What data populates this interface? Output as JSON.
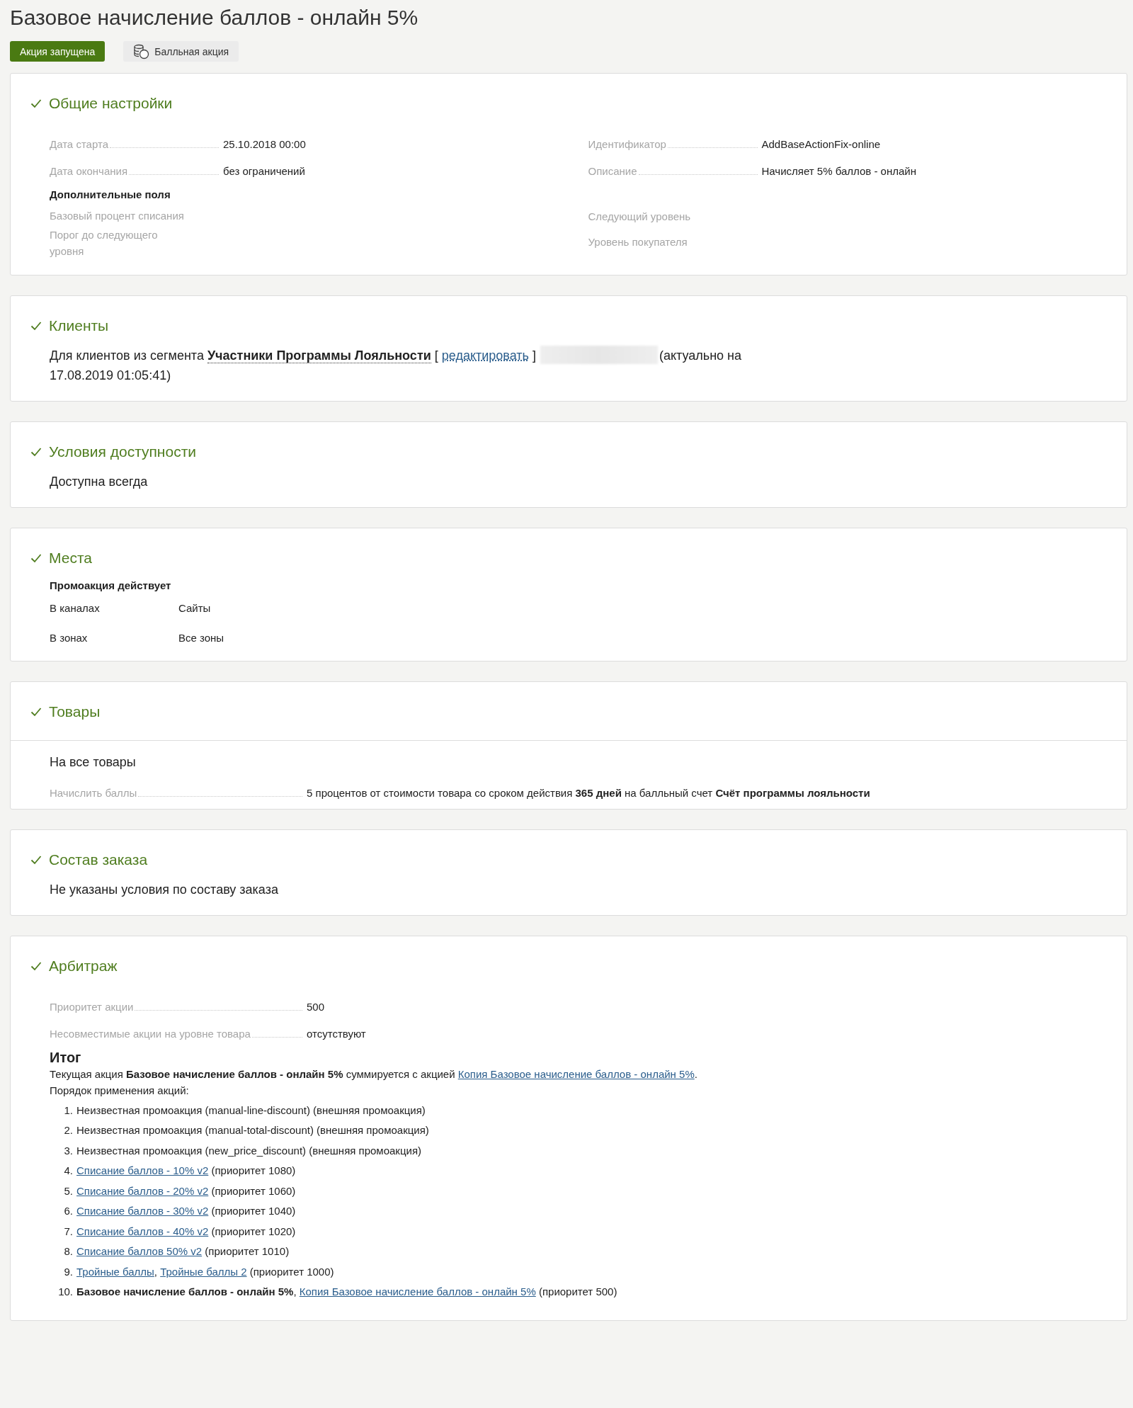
{
  "title": "Базовое начисление баллов - онлайн 5%",
  "badges": [
    {
      "kind": "status",
      "label": "Акция запущена"
    },
    {
      "kind": "type",
      "label": "Балльная акция"
    }
  ],
  "sections": [
    {
      "kind": "general",
      "title": "Общие настройки",
      "complete": true,
      "left_fields": [
        {
          "label": "Дата старта",
          "value": "25.10.2018 00:00"
        },
        {
          "label": "Дата окончания",
          "value": "без ограничений"
        }
      ],
      "right_fields": [
        {
          "label": "Идентификатор",
          "value": "AddBaseActionFix-online"
        },
        {
          "label": "Описание",
          "value": "Начисляет 5% баллов - онлайн"
        }
      ],
      "extra_title": "Дополнительные поля",
      "extra_left": [
        "Базовый процент списания",
        "Порог до следующего уровня"
      ],
      "extra_right": [
        "Следующий уровень",
        "Уровень покупателя"
      ]
    },
    {
      "kind": "clients",
      "title": "Клиенты",
      "complete": true,
      "before": "Для клиентов из сегмента",
      "segment": "Участники Программы Лояльности",
      "open": "[",
      "link": "редактировать",
      "close": "]",
      "after": "(актуально на 17.08.2019 01:05:41)"
    },
    {
      "kind": "text",
      "title": "Условия доступности",
      "complete": true,
      "text": "Доступна всегда"
    },
    {
      "kind": "places",
      "title": "Места",
      "complete": true,
      "subtitle": "Промоакция действует",
      "rows": [
        {
          "label": "В каналах",
          "value": "Сайты"
        },
        {
          "label": "В зонах",
          "value": "Все зоны"
        }
      ]
    },
    {
      "kind": "products",
      "title": "Товары",
      "complete": true,
      "text": "На все товары",
      "field": {
        "label": "Начислить баллы",
        "value": "5 процентов от стоимости товара со сроком действия **365 дней** на балльный счет **Счёт программы лояльности**"
      }
    },
    {
      "kind": "text",
      "title": "Состав заказа",
      "complete": true,
      "text": "Не указаны условия по составу заказа"
    },
    {
      "kind": "arbitration",
      "title": "Арбитраж",
      "complete": true,
      "fields": [
        {
          "label": "Приоритет акции",
          "value": "500"
        },
        {
          "label": "Несовместимые акции на уровне товара",
          "value": "отсутствуют"
        }
      ],
      "summary_title": "Итог",
      "summary": [
        {
          "kind": "text",
          "text": "Текущая акция **Базовое начисление баллов - онлайн 5%** суммируется с акцией "
        },
        {
          "kind": "link",
          "text": "Копия Базовое начисление баллов - онлайн 5%"
        },
        {
          "kind": "text",
          "text": "."
        }
      ],
      "order_title": "Порядок применения акций:",
      "order": [
        {
          "number": "1.",
          "parts": [
            {
              "kind": "text",
              "text": "Неизвестная промоакция (manual-line-discount) (внешняя промоакция)"
            }
          ]
        },
        {
          "number": "2.",
          "parts": [
            {
              "kind": "text",
              "text": "Неизвестная промоакция (manual-total-discount) (внешняя промоакция)"
            }
          ]
        },
        {
          "number": "3.",
          "parts": [
            {
              "kind": "text",
              "text": "Неизвестная промоакция (new_price_discount) (внешняя промоакция)"
            }
          ]
        },
        {
          "number": "4.",
          "parts": [
            {
              "kind": "link",
              "text": "Списание баллов - 10% v2"
            },
            {
              "kind": "text",
              "text": " (приоритет 1080)"
            }
          ]
        },
        {
          "number": "5.",
          "parts": [
            {
              "kind": "link",
              "text": "Списание баллов - 20% v2"
            },
            {
              "kind": "text",
              "text": " (приоритет 1060)"
            }
          ]
        },
        {
          "number": "6.",
          "parts": [
            {
              "kind": "link",
              "text": "Списание баллов - 30% v2"
            },
            {
              "kind": "text",
              "text": " (приоритет 1040)"
            }
          ]
        },
        {
          "number": "7.",
          "parts": [
            {
              "kind": "link",
              "text": "Списание баллов - 40% v2"
            },
            {
              "kind": "text",
              "text": " (приоритет 1020)"
            }
          ]
        },
        {
          "number": "8.",
          "parts": [
            {
              "kind": "link",
              "text": "Списание баллов 50% v2"
            },
            {
              "kind": "text",
              "text": " (приоритет 1010)"
            }
          ]
        },
        {
          "number": "9.",
          "parts": [
            {
              "kind": "link",
              "text": "Тройные баллы"
            },
            {
              "kind": "text",
              "text": ", "
            },
            {
              "kind": "link",
              "text": "Тройные баллы 2"
            },
            {
              "kind": "text",
              "text": " (приоритет 1000)"
            }
          ]
        },
        {
          "number": "10.",
          "parts": [
            {
              "kind": "text",
              "text": "**Базовое начисление баллов - онлайн 5%**, "
            },
            {
              "kind": "link",
              "text": "Копия Базовое начисление баллов - онлайн 5%"
            },
            {
              "kind": "text",
              "text": " (приоритет 500)"
            }
          ]
        }
      ]
    }
  ]
}
